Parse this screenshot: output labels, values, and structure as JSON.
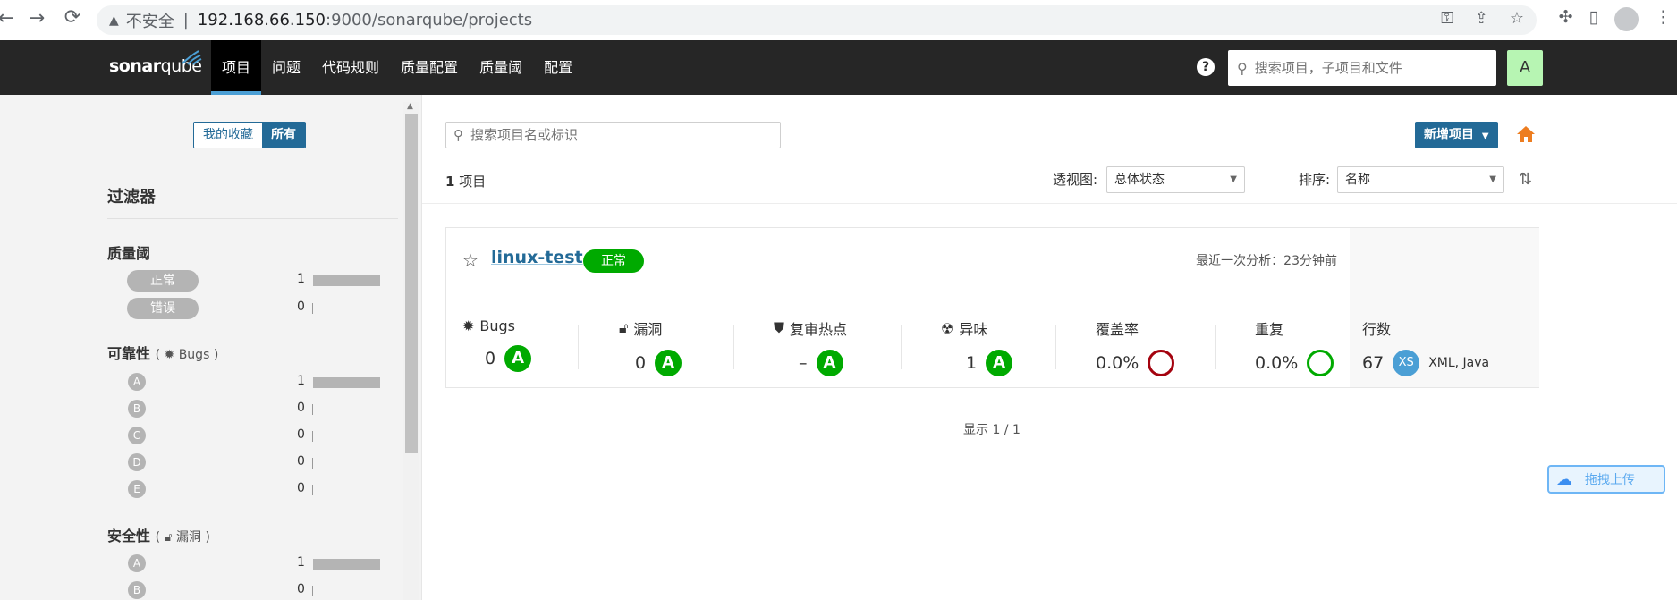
{
  "browser": {
    "back_icon": "arrow-left-icon",
    "forward_icon": "arrow-right-icon",
    "reload_icon": "reload-icon",
    "insecure_label": "不安全",
    "host": "192.168.66.150",
    "path": ":9000/sonarqube/projects"
  },
  "topnav": {
    "logo_bold": "sonar",
    "logo_light": "qube",
    "items": [
      "项目",
      "问题",
      "代码规则",
      "质量配置",
      "质量阈",
      "配置"
    ],
    "active": "项目",
    "help": "?",
    "search_placeholder": "搜索项目，子项目和文件",
    "avatar": "A"
  },
  "sidebar": {
    "toggle_fav": "我的收藏",
    "toggle_all": "所有",
    "filters_title": "过滤器",
    "quality_gate": {
      "title": "质量阈",
      "rows": [
        {
          "label": "正常",
          "count": "1",
          "fill": 1
        },
        {
          "label": "错误",
          "count": "0",
          "fill": 0
        }
      ]
    },
    "reliability": {
      "title": "可靠性",
      "sub": "Bugs",
      "rows": [
        {
          "label": "A",
          "count": "1",
          "fill": 1
        },
        {
          "label": "B",
          "count": "0",
          "fill": 0
        },
        {
          "label": "C",
          "count": "0",
          "fill": 0
        },
        {
          "label": "D",
          "count": "0",
          "fill": 0
        },
        {
          "label": "E",
          "count": "0",
          "fill": 0
        }
      ]
    },
    "security": {
      "title": "安全性",
      "sub": "漏洞",
      "rows": [
        {
          "label": "A",
          "count": "1",
          "fill": 1
        },
        {
          "label": "B",
          "count": "0",
          "fill": 0
        }
      ]
    }
  },
  "main": {
    "search_placeholder": "搜索项目名或标识",
    "new_project": "新增项目",
    "count_num": "1",
    "count_label": "项目",
    "perspective_label": "透视图:",
    "perspective_value": "总体状态",
    "sort_label": "排序:",
    "sort_value": "名称",
    "showing": "显示 1 / 1"
  },
  "project": {
    "name": "linux-test",
    "status": "正常",
    "last_analysis": "最近一次分析：23分钟前",
    "bugs": {
      "label": "Bugs",
      "value": "0",
      "grade": "A"
    },
    "vulns": {
      "label": "漏洞",
      "value": "0",
      "grade": "A"
    },
    "hotspots": {
      "label": "复审热点",
      "value": "–",
      "grade": "A"
    },
    "smells": {
      "label": "异味",
      "value": "1",
      "grade": "A"
    },
    "coverage": {
      "label": "覆盖率",
      "value": "0.0%"
    },
    "duplications": {
      "label": "重复",
      "value": "0.0%"
    },
    "lines": {
      "label": "行数",
      "value": "67",
      "size": "XS",
      "languages": "XML, Java"
    }
  },
  "upload": {
    "label": "拖拽上传"
  },
  "colors": {
    "accent": "#236a97",
    "ok": "#00aa00",
    "error": "#a4030f",
    "nav_bg": "#262626"
  }
}
